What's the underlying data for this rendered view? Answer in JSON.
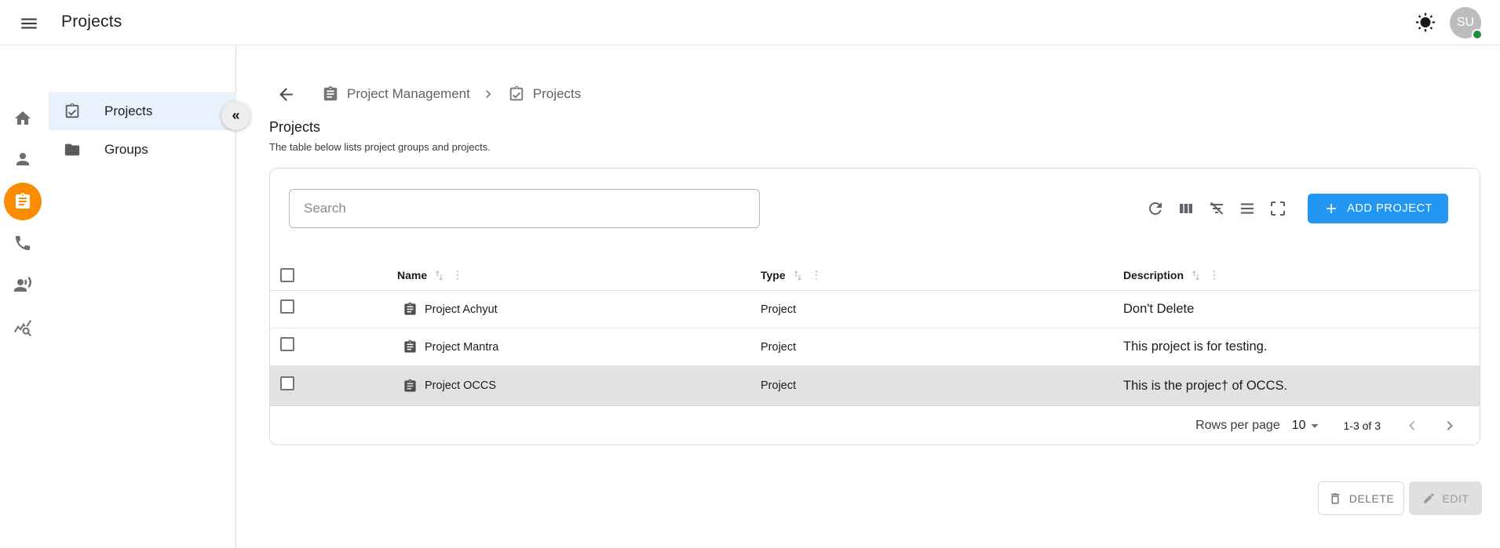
{
  "topbar": {
    "title": "Projects",
    "avatar_initials": "SU"
  },
  "sidebar": {
    "section_label": "Project Management",
    "collapse_glyph": "«",
    "items": [
      {
        "label": "Projects",
        "active": true
      },
      {
        "label": "Groups",
        "active": false
      }
    ],
    "rail_icons": [
      "home-icon",
      "person-icon",
      "assignment-icon-active",
      "phone-icon",
      "record-voice-over-icon",
      "query-stats-icon"
    ]
  },
  "breadcrumb": {
    "parent": "Project Management",
    "current": "Projects"
  },
  "page": {
    "title": "Projects",
    "subtitle": "The table below lists project groups and projects."
  },
  "toolbar": {
    "search_placeholder": "Search",
    "add_button": "ADD PROJECT",
    "icons": [
      "refresh-icon",
      "view-columns-icon",
      "filter-off-icon",
      "density-icon",
      "fullscreen-icon"
    ]
  },
  "table": {
    "columns": [
      "Name",
      "Type",
      "Description"
    ],
    "rows": [
      {
        "name": "Project Achyut",
        "type": "Project",
        "description": "Don't Delete",
        "selected": false
      },
      {
        "name": "Project Mantra",
        "type": "Project",
        "description": "This project is for testing.",
        "selected": false
      },
      {
        "name": "Project OCCS",
        "type": "Project",
        "description": "This is the projec† of OCCS.",
        "selected": true
      }
    ]
  },
  "pagination": {
    "rows_per_page_label": "Rows per page",
    "rows_per_page_value": "10",
    "range": "1-3 of 3"
  },
  "actions": {
    "delete": "DELETE",
    "edit": "EDIT"
  },
  "colors": {
    "accent_blue": "#2196f3",
    "active_orange": "#fb8c00",
    "selected_item_bg": "#e9f1fc",
    "selected_row_bg": "#e2e2e2",
    "avatar_bg": "#bdbdbd",
    "online_green": "#1e8e3e"
  }
}
